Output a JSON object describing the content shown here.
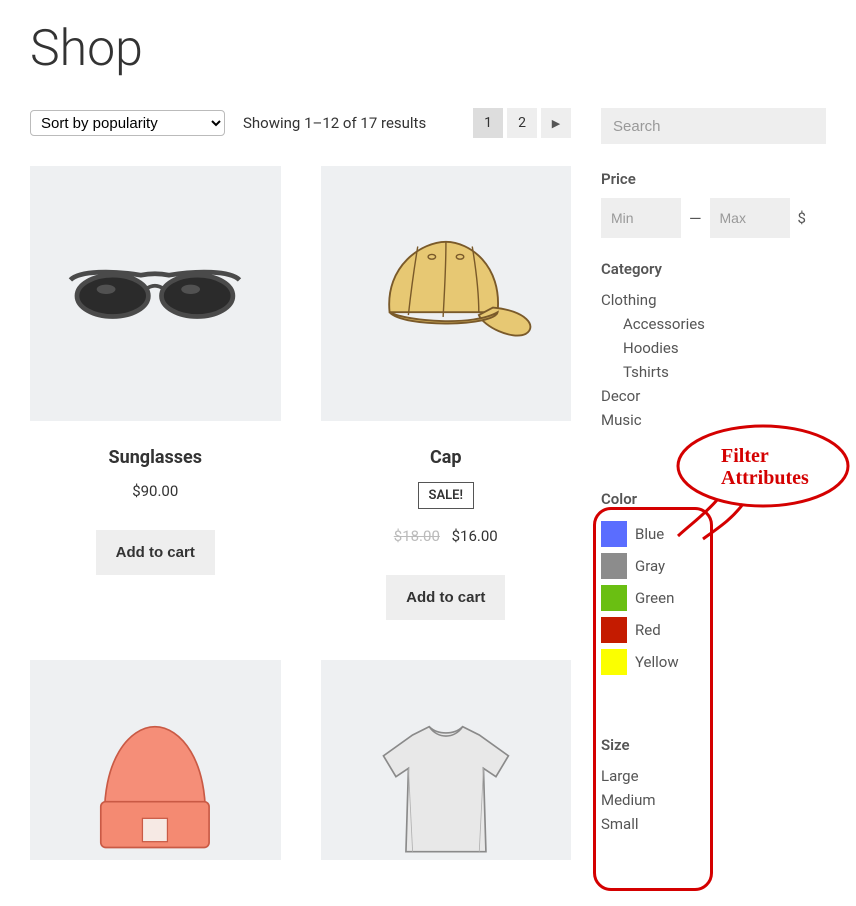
{
  "page_title": "Shop",
  "sort": {
    "selected": "Sort by popularity"
  },
  "results_text": "Showing 1–12 of 17 results",
  "pagination": {
    "page1": "1",
    "page2": "2"
  },
  "products": [
    {
      "name": "Sunglasses",
      "price": "$90.00",
      "button": "Add to cart"
    },
    {
      "name": "Cap",
      "sale_badge": "SALE!",
      "old_price": "$18.00",
      "price": "$16.00",
      "button": "Add to cart"
    }
  ],
  "sidebar": {
    "search_placeholder": "Search",
    "price": {
      "title": "Price",
      "min_placeholder": "Min",
      "dash": "—",
      "max_placeholder": "Max",
      "currency": "$"
    },
    "category": {
      "title": "Category",
      "items": [
        "Clothing",
        "Accessories",
        "Hoodies",
        "Tshirts",
        "Decor",
        "Music"
      ]
    },
    "annotation": {
      "line1": "Filter",
      "line2": "Attributes"
    },
    "color": {
      "title": "Color",
      "items": [
        {
          "label": "Blue",
          "hex": "#5a6dff"
        },
        {
          "label": "Gray",
          "hex": "#8c8c8c"
        },
        {
          "label": "Green",
          "hex": "#6abf12"
        },
        {
          "label": "Red",
          "hex": "#c41b00"
        },
        {
          "label": "Yellow",
          "hex": "#fbff00"
        }
      ]
    },
    "size": {
      "title": "Size",
      "items": [
        "Large",
        "Medium",
        "Small"
      ]
    }
  }
}
